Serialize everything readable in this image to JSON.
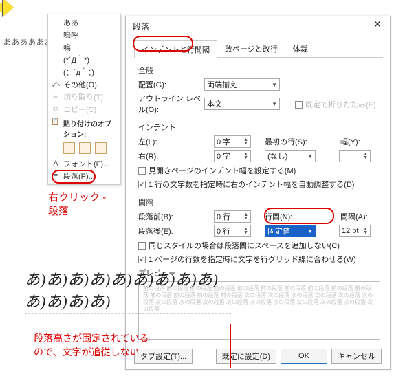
{
  "doc_sample_text": "あああああああ",
  "context_menu": {
    "items": [
      {
        "icon": "",
        "label": "ああ"
      },
      {
        "icon": "",
        "label": "嗚呼"
      },
      {
        "icon": "",
        "label": "嗚"
      },
      {
        "icon": "",
        "label": "(*´Д｀*)"
      },
      {
        "icon": "",
        "label": "(；´д｀；)"
      },
      {
        "icon": "⤺",
        "label": "その他(O)..."
      },
      {
        "icon": "✂",
        "label": "切り取り(T)"
      },
      {
        "icon": "⧉",
        "label": "コピー(C)"
      }
    ],
    "paste_header": "貼り付けのオプション:",
    "items2": [
      {
        "icon": "A",
        "label": "フォント(F)..."
      },
      {
        "icon": "≡",
        "label": "段落(P)..."
      }
    ]
  },
  "annotation1_line1": "右クリック -",
  "annotation1_line2": "段落",
  "dialog": {
    "title": "段落",
    "tabs": [
      "インデントと行間隔",
      "改ページと改行",
      "体裁"
    ],
    "general_header": "全般",
    "align_label": "配置(G):",
    "align_value": "両端揃え",
    "outline_label": "アウトライン レベル(O):",
    "outline_value": "本文",
    "fold_label": "既定で折りたたみ(E)",
    "indent_header": "インデント",
    "left_label": "左(L):",
    "left_value": "0 字",
    "right_label": "右(R):",
    "right_value": "0 字",
    "first_label": "最初の行(S):",
    "first_value": "(なし)",
    "width_label": "幅(Y):",
    "mirror_label": "見開きページのインデント幅を設定する(M)",
    "autoindent_label": "1 行の文字数を指定時に右のインデント幅を自動調整する(D)",
    "spacing_header": "間隔",
    "before_label": "段落前(B):",
    "before_value": "0 行",
    "after_label": "段落後(E):",
    "after_value": "0 行",
    "lh_label": "行間(N):",
    "lh_value": "固定値",
    "gap_label": "間隔(A):",
    "gap_value": "12 pt",
    "nospc_label": "同じスタイルの場合は段落間にスペースを追加しない(C)",
    "fitgrid_label": "1 ページの行数を指定時に文字を行グリッド線に合わせる(W)",
    "preview_header": "プレビュー",
    "preview_gray": "前の段落 前の段落 前の段落 前の段落 前の段落 前の段落 前の段落 前の段落 前の段落 前の段落 前の段落 前の段落 前の段落 前の段落 次の段落 次の段落 次の段落 次の段落 次の段落 次の段落 次の段落 次の段落 次の段落 次の段落 次の段落 次の段落 次の段落 次の段落 次の段落 次の段落",
    "btn_tab": "タブ設定(T)...",
    "btn_default": "既定に設定(D)",
    "btn_ok": "OK",
    "btn_cancel": "キャンセル"
  },
  "example_letters": "あ)あ)あ)あ)あ)あ)あ)あ)あ)あ)あ)あ)あ)",
  "example_note_line1": "段落高さが固定されている",
  "example_note_line2": "ので、文字が追従しない"
}
